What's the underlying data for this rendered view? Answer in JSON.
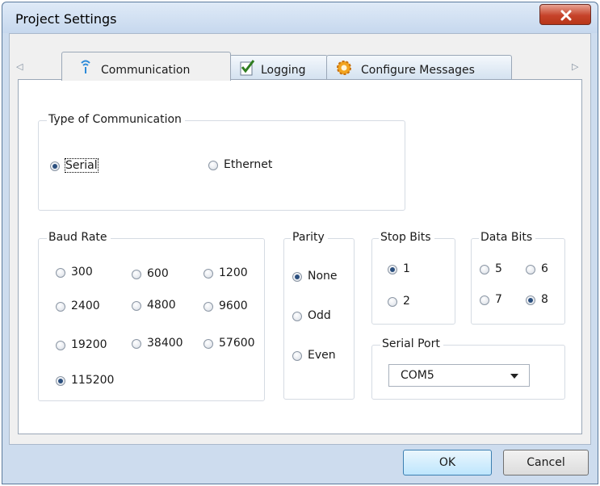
{
  "window": {
    "title": "Project Settings",
    "close_glyph": "✕"
  },
  "tabs": [
    {
      "label": "Communication",
      "icon": "wireless-icon",
      "active": true
    },
    {
      "label": "Logging",
      "icon": "checklist-icon",
      "active": false
    },
    {
      "label": "Configure Messages",
      "icon": "gear-icon",
      "active": false
    }
  ],
  "scroll": {
    "left": "◁",
    "right": "▷"
  },
  "communication_type": {
    "title": "Type of Communication",
    "options": [
      {
        "label": "Serial",
        "checked": true
      },
      {
        "label": "Ethernet",
        "checked": false
      }
    ]
  },
  "baud_rate": {
    "title": "Baud Rate",
    "options": [
      {
        "label": "300",
        "checked": false
      },
      {
        "label": "600",
        "checked": false
      },
      {
        "label": "1200",
        "checked": false
      },
      {
        "label": "2400",
        "checked": false
      },
      {
        "label": "4800",
        "checked": false
      },
      {
        "label": "9600",
        "checked": false
      },
      {
        "label": "19200",
        "checked": false
      },
      {
        "label": "38400",
        "checked": false
      },
      {
        "label": "57600",
        "checked": false
      },
      {
        "label": "115200",
        "checked": true
      }
    ]
  },
  "parity": {
    "title": "Parity",
    "options": [
      {
        "label": "None",
        "checked": true
      },
      {
        "label": "Odd",
        "checked": false
      },
      {
        "label": "Even",
        "checked": false
      }
    ]
  },
  "stop_bits": {
    "title": "Stop Bits",
    "options": [
      {
        "label": "1",
        "checked": true
      },
      {
        "label": "2",
        "checked": false
      }
    ]
  },
  "data_bits": {
    "title": "Data Bits",
    "options": [
      {
        "label": "5",
        "checked": false
      },
      {
        "label": "6",
        "checked": false
      },
      {
        "label": "7",
        "checked": false
      },
      {
        "label": "8",
        "checked": true
      }
    ]
  },
  "serial_port": {
    "title": "Serial Port",
    "value": "COM5"
  },
  "buttons": {
    "ok": "OK",
    "cancel": "Cancel"
  },
  "colors": {
    "title_bar": "#c6d8ee",
    "close_button": "#c6432a",
    "selected_radio": "#2b4f7e",
    "default_button": "#bee6fd"
  }
}
